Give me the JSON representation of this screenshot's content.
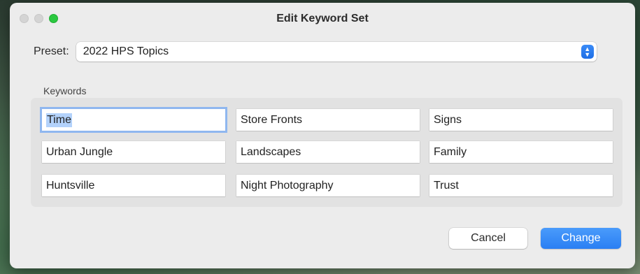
{
  "window": {
    "title": "Edit Keyword Set"
  },
  "colors": {
    "accent": "#2a7ff3",
    "focus_ring": "#8fb7ef",
    "maximize": "#2bc840"
  },
  "preset": {
    "label": "Preset:",
    "value": "2022 HPS Topics",
    "icon": "up-down-stepper-icon"
  },
  "keywords": {
    "label": "Keywords",
    "fields": [
      [
        "Time",
        "Store Fronts",
        "Signs"
      ],
      [
        "Urban Jungle",
        "Landscapes",
        "Family"
      ],
      [
        "Huntsville",
        "Night Photography",
        "Trust"
      ]
    ]
  },
  "buttons": {
    "cancel": "Cancel",
    "change": "Change"
  }
}
